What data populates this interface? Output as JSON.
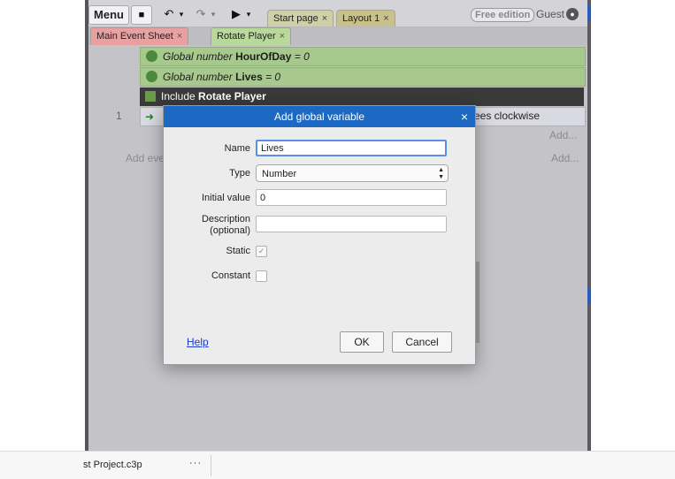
{
  "toolbar": {
    "menu_label": "Menu",
    "tabs": [
      {
        "label": "Start page",
        "close": "×"
      },
      {
        "label": "Layout 1",
        "close": "×"
      }
    ],
    "edition_label": "Free edition",
    "user_label": "Guest"
  },
  "sheet_tabs": [
    {
      "label": "Main Event Sheet",
      "close": "×"
    },
    {
      "label": "Rotate Player",
      "close": "×"
    }
  ],
  "event_sheet": {
    "globals": [
      {
        "prefix": "Global number",
        "name": "HourOfDay",
        "value": "= 0"
      },
      {
        "prefix": "Global number",
        "name": "Lives",
        "value": "= 0"
      }
    ],
    "include": {
      "prefix": "Include",
      "name": "Rotate Player"
    },
    "event_number": "1",
    "action_text": "rees clockwise",
    "add_action": "Add...",
    "add_event": "Add eve",
    "add_action_2": "Add..."
  },
  "dialog": {
    "title": "Add global variable",
    "close": "×",
    "labels": {
      "name": "Name",
      "type": "Type",
      "initial_value": "Initial value",
      "description": "Description",
      "description_sub": "(optional)",
      "static": "Static",
      "constant": "Constant"
    },
    "values": {
      "name": "Lives",
      "type": "Number",
      "initial_value": "0",
      "description": ""
    },
    "static_checked": true,
    "constant_checked": false,
    "help": "Help",
    "ok": "OK",
    "cancel": "Cancel"
  },
  "status_bar": {
    "project_name": "st Project.c3p",
    "more": "···"
  }
}
